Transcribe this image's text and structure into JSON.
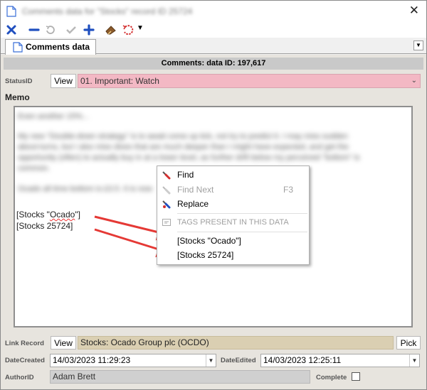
{
  "window": {
    "title": "Comments data for \"Stocks\" record ID 25724"
  },
  "tab": {
    "label": "Comments data"
  },
  "form": {
    "header": "Comments: data ID: 197,617",
    "status": {
      "label": "StatusID",
      "view_label": "View",
      "value": "01. Important: Watch"
    },
    "memo": {
      "label": "Memo",
      "blurred_lines": [
        "Even another 15%...",
        "My new \"Double-down strategy\" is to await come up tick, not try to predict it. I may miss sudden",
        "about-turns, but I also miss dives that are much deeper than I might have expected, and get the",
        "opportunity (often) to actually buy in at a lower level, as further drift below my perceived \"bottom\" is",
        "common.",
        "Ocado all time bottom is £3.5. It is now"
      ],
      "tags": [
        "[Stocks \"Ocado\"]",
        "[Stocks 25724]"
      ]
    },
    "link_record": {
      "label": "Link Record",
      "view_label": "View",
      "value": "Stocks: Ocado Group plc (OCDO)",
      "pick_label": "Pick"
    },
    "date_created": {
      "label": "DateCreated",
      "value": "14/03/2023 11:29:23"
    },
    "date_edited": {
      "label": "DateEdited",
      "value": "14/03/2023 12:25:11"
    },
    "author": {
      "label": "AuthorID",
      "value": "Adam Brett"
    },
    "complete": {
      "label": "Complete",
      "checked": false
    }
  },
  "context_menu": {
    "find": "Find",
    "find_next": "Find Next",
    "find_next_shortcut": "F3",
    "replace": "Replace",
    "tags_header": "TAGS PRESENT IN THIS DATA",
    "tag_items": [
      "[Stocks \"Ocado\"]",
      "[Stocks 25724]"
    ]
  },
  "colors": {
    "status_bg": "#f3b8c4",
    "link_bg": "#dacfb2",
    "annotation_arrow": "#e53935",
    "toolbar_blue": "#1f4fbf"
  }
}
